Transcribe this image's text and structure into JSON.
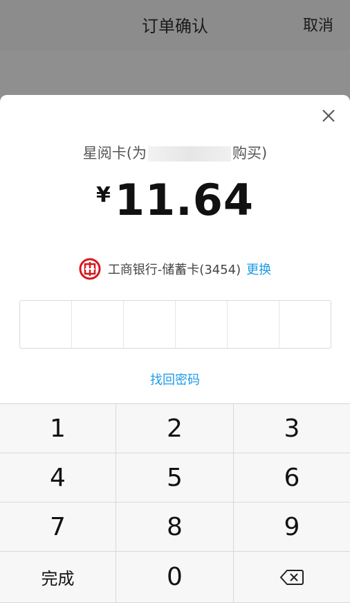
{
  "background": {
    "title": "订单确认",
    "cancel_label": "取消"
  },
  "payment": {
    "product_prefix": "星阅卡(为",
    "product_suffix": "购买)",
    "currency_symbol": "¥",
    "amount": "11.64",
    "bank_label": "工商银行-储蓄卡(3454)",
    "change_label": "更换",
    "forgot_password_label": "找回密码"
  },
  "keypad": {
    "keys": [
      "1",
      "2",
      "3",
      "4",
      "5",
      "6",
      "7",
      "8",
      "9"
    ],
    "done_label": "完成",
    "zero": "0"
  },
  "colors": {
    "accent": "#1c9be6",
    "bank_red": "#d7161c"
  },
  "icons": {
    "close": "close-icon",
    "bank": "icbc-logo-icon",
    "backspace": "backspace-icon"
  }
}
